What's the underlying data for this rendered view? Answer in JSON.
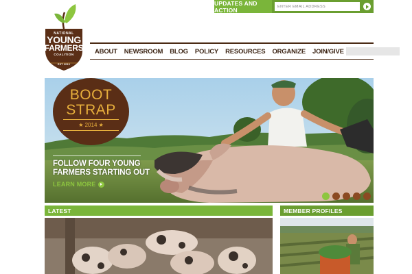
{
  "signup": {
    "label": "UPDATES AND ACTION",
    "email_placeholder": "ENTER EMAIL ADDRESS",
    "submit_icon": "arrow-right-icon"
  },
  "logo": {
    "line1": "NATIONAL",
    "line2": "YOUNG",
    "line3": "FARMERS",
    "line4": "COALITION",
    "est": "EST 2010",
    "icon": "leaf-icon"
  },
  "nav": {
    "items": [
      "ABOUT",
      "NEWSROOM",
      "BLOG",
      "POLICY",
      "RESOURCES",
      "ORGANIZE",
      "JOIN/GIVE"
    ],
    "search_placeholder": "",
    "search_icon": "search-icon"
  },
  "hero": {
    "badge_line1": "BOOT",
    "badge_line2": "STRAP",
    "badge_year": "★ 2014 ★",
    "headline": "FOLLOW FOUR YOUNG FARMERS STARTING OUT",
    "link_label": "LEARN MORE",
    "slides": 5,
    "active_slide": 1
  },
  "sections": {
    "latest": "LATEST",
    "member_profiles": "MEMBER PROFILES"
  },
  "colors": {
    "brand_green": "#7ab53a",
    "dark_green": "#6a9e30",
    "brand_brown": "#5a2e16",
    "accent_gold": "#e8b03c",
    "dot_green": "#8dc63f",
    "dot_brown": "#8b4a22"
  }
}
